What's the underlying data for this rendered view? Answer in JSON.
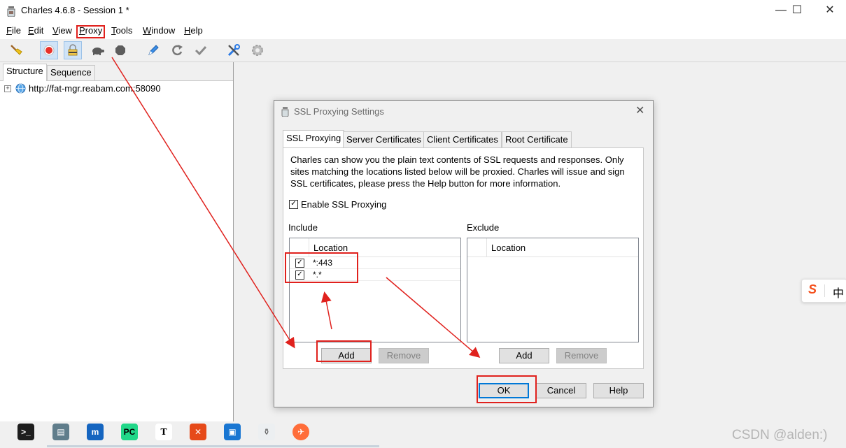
{
  "window": {
    "title": "Charles 4.6.8 - Session 1 *",
    "minimize_glyph": "—",
    "maximize_glyph": "☐",
    "close_glyph": "✕"
  },
  "menubar": {
    "items": [
      {
        "mnemonic": "F",
        "rest": "ile"
      },
      {
        "mnemonic": "E",
        "rest": "dit"
      },
      {
        "mnemonic": "V",
        "rest": "iew"
      },
      {
        "mnemonic": "P",
        "rest": "roxy"
      },
      {
        "mnemonic": "T",
        "rest": "ools"
      },
      {
        "mnemonic": "W",
        "rest": "indow"
      },
      {
        "mnemonic": "H",
        "rest": "elp"
      }
    ]
  },
  "toolbar": {
    "icons": [
      "broom-icon",
      "record-icon",
      "ssl-lock-icon",
      "turtle-throttle-icon",
      "stop-breakpoint-icon",
      "compose-pen-icon",
      "repeat-icon",
      "validate-check-icon",
      "tools-icon",
      "settings-gear-icon"
    ]
  },
  "left_panel": {
    "tabs": [
      "Structure",
      "Sequence"
    ],
    "active_tab": "Structure",
    "tree": [
      {
        "expander": "+",
        "label": "http://fat-mgr.reabam.com:58090"
      }
    ]
  },
  "dialog": {
    "title": "SSL Proxying Settings",
    "close_glyph": "✕",
    "tabs": [
      "SSL Proxying",
      "Server Certificates",
      "Client Certificates",
      "Root Certificate"
    ],
    "active_tab": "SSL Proxying",
    "description": "Charles can show you the plain text contents of SSL requests and responses. Only sites matching the locations listed below will be proxied. Charles will issue and sign SSL certificates, please press the Help button for more information.",
    "enable_label": "Enable SSL Proxying",
    "enable_checked": true,
    "include": {
      "label": "Include",
      "column": "Location",
      "rows": [
        {
          "checked": true,
          "location": "*:443"
        },
        {
          "checked": true,
          "location": "*.*"
        }
      ],
      "add_label": "Add",
      "remove_label": "Remove"
    },
    "exclude": {
      "label": "Exclude",
      "column": "Location",
      "rows": [],
      "add_label": "Add",
      "remove_label": "Remove"
    },
    "ok_label": "OK",
    "cancel_label": "Cancel",
    "help_label": "Help"
  },
  "ime": {
    "logo": "S",
    "mode": "中"
  },
  "watermark": "CSDN @alden:)",
  "colors": {
    "annotation_red": "#e0211d",
    "focus_blue": "#0078d7",
    "record_red": "#e8312a"
  }
}
